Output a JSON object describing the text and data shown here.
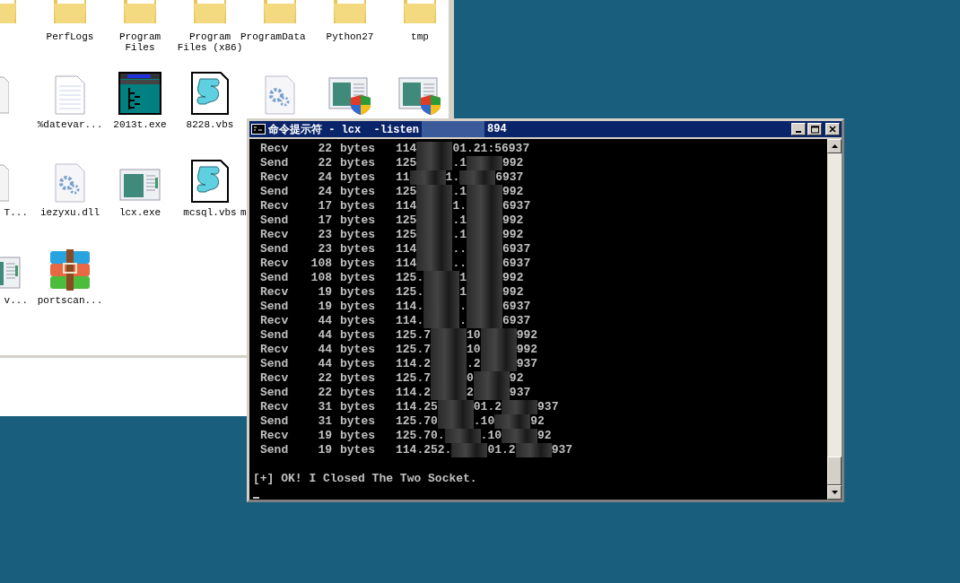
{
  "explorer": {
    "icons": [
      {
        "kind": "folder"
      },
      {
        "kind": "folder",
        "label": "PerfLogs"
      },
      {
        "kind": "folder",
        "label": "Program Files"
      },
      {
        "kind": "folder",
        "label": "Program Files (x86)"
      },
      {
        "kind": "folder",
        "label": "ProgramData"
      },
      {
        "kind": "folder",
        "label": "Python27"
      },
      {
        "kind": "folder",
        "label": "tmp"
      },
      {
        "kind": "file"
      },
      {
        "kind": "text",
        "label": "%datevar..."
      },
      {
        "kind": "tree",
        "label": "2013t.exe"
      },
      {
        "kind": "script",
        "label": "8228.vbs"
      },
      {
        "kind": "gear"
      },
      {
        "kind": "shield"
      },
      {
        "kind": "shield"
      },
      {
        "kind": "file",
        "label": "T..."
      },
      {
        "kind": "gear",
        "label": "iezyxu.dll"
      },
      {
        "kind": "app",
        "label": "lcx.exe"
      },
      {
        "kind": "script",
        "label": "mcsql.vbs"
      },
      {
        "kind": "none",
        "label": "m"
      },
      {
        "kind": "none"
      },
      {
        "kind": "none"
      },
      {
        "kind": "app",
        "label": "v..."
      },
      {
        "kind": "archive",
        "label": "portscan..."
      }
    ]
  },
  "console": {
    "title_parts": [
      "命令提示符 - lcx  -listen",
      "894"
    ],
    "rows": [
      {
        "dir": "Recv",
        "count": "22",
        "unit": "bytes",
        "address_parts": [
          "114",
          "01.21:56937"
        ]
      },
      {
        "dir": "Send",
        "count": "22",
        "unit": "bytes",
        "address_parts": [
          "125",
          ".1",
          "992"
        ]
      },
      {
        "dir": "Recv",
        "count": "24",
        "unit": "bytes",
        "address_parts": [
          "11",
          "1.",
          "6937"
        ]
      },
      {
        "dir": "Send",
        "count": "24",
        "unit": "bytes",
        "address_parts": [
          "125",
          ".1",
          "992"
        ]
      },
      {
        "dir": "Recv",
        "count": "17",
        "unit": "bytes",
        "address_parts": [
          "114",
          "1.",
          "6937"
        ]
      },
      {
        "dir": "Send",
        "count": "17",
        "unit": "bytes",
        "address_parts": [
          "125",
          ".1",
          "992"
        ]
      },
      {
        "dir": "Recv",
        "count": "23",
        "unit": "bytes",
        "address_parts": [
          "125",
          ".1",
          "992"
        ]
      },
      {
        "dir": "Send",
        "count": "23",
        "unit": "bytes",
        "address_parts": [
          "114",
          "..",
          "6937"
        ]
      },
      {
        "dir": "Recv",
        "count": "108",
        "unit": "bytes",
        "address_parts": [
          "114",
          "..",
          "6937"
        ]
      },
      {
        "dir": "Send",
        "count": "108",
        "unit": "bytes",
        "address_parts": [
          "125.",
          "1",
          "992"
        ]
      },
      {
        "dir": "Recv",
        "count": "19",
        "unit": "bytes",
        "address_parts": [
          "125.",
          "1",
          "992"
        ]
      },
      {
        "dir": "Send",
        "count": "19",
        "unit": "bytes",
        "address_parts": [
          "114.",
          ".",
          "6937"
        ]
      },
      {
        "dir": "Recv",
        "count": "44",
        "unit": "bytes",
        "address_parts": [
          "114.",
          ".",
          "6937"
        ]
      },
      {
        "dir": "Send",
        "count": "44",
        "unit": "bytes",
        "address_parts": [
          "125.7",
          "10",
          "992"
        ]
      },
      {
        "dir": "Recv",
        "count": "44",
        "unit": "bytes",
        "address_parts": [
          "125.7",
          "10",
          "992"
        ]
      },
      {
        "dir": "Send",
        "count": "44",
        "unit": "bytes",
        "address_parts": [
          "114.2",
          ".2",
          "937"
        ]
      },
      {
        "dir": "Recv",
        "count": "22",
        "unit": "bytes",
        "address_parts": [
          "125.7",
          "0",
          "92"
        ]
      },
      {
        "dir": "Send",
        "count": "22",
        "unit": "bytes",
        "address_parts": [
          "114.2",
          "2",
          "937"
        ]
      },
      {
        "dir": "Recv",
        "count": "31",
        "unit": "bytes",
        "address_parts": [
          "114.25",
          "01.2",
          "937"
        ]
      },
      {
        "dir": "Send",
        "count": "31",
        "unit": "bytes",
        "address_parts": [
          "125.70",
          ".10",
          "92"
        ]
      },
      {
        "dir": "Recv",
        "count": "19",
        "unit": "bytes",
        "address_parts": [
          "125.70.",
          ".10",
          "92"
        ]
      },
      {
        "dir": "Send",
        "count": "19",
        "unit": "bytes",
        "address_parts": [
          "114.252.",
          "01.2",
          "937"
        ]
      }
    ],
    "message": "[+] OK! I Closed The Two Socket."
  }
}
